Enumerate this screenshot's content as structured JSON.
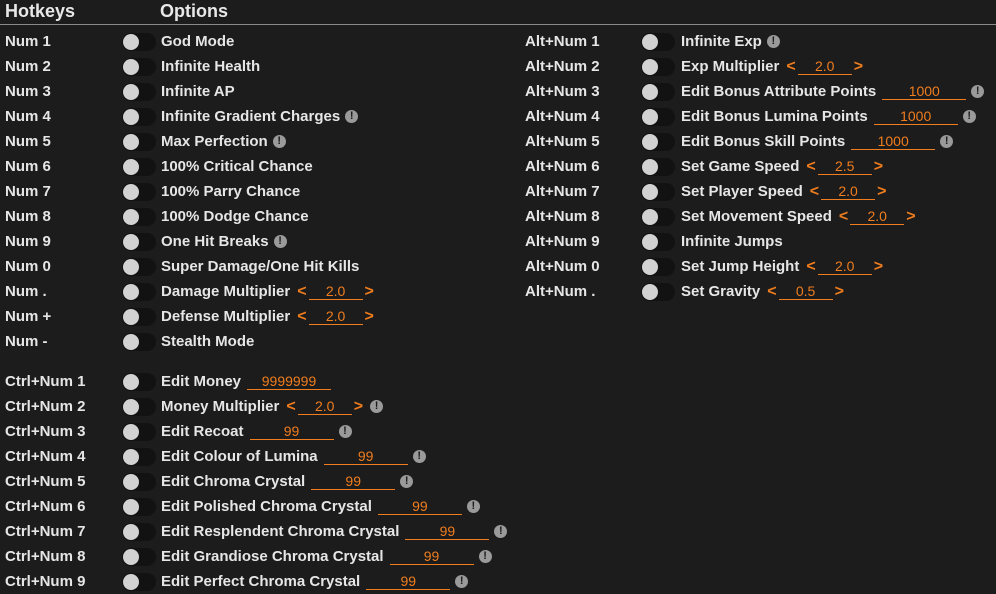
{
  "header": {
    "hotkeys_label": "Hotkeys",
    "options_label": "Options"
  },
  "left_column": [
    {
      "hotkey": "Num 1",
      "label": "God Mode"
    },
    {
      "hotkey": "Num 2",
      "label": "Infinite Health"
    },
    {
      "hotkey": "Num 3",
      "label": "Infinite AP"
    },
    {
      "hotkey": "Num 4",
      "label": "Infinite Gradient Charges",
      "info": true
    },
    {
      "hotkey": "Num 5",
      "label": "Max Perfection",
      "info": true
    },
    {
      "hotkey": "Num 6",
      "label": "100% Critical Chance"
    },
    {
      "hotkey": "Num 7",
      "label": "100% Parry Chance"
    },
    {
      "hotkey": "Num 8",
      "label": "100% Dodge Chance"
    },
    {
      "hotkey": "Num 9",
      "label": "One Hit Breaks",
      "info": true
    },
    {
      "hotkey": "Num 0",
      "label": "Super Damage/One Hit Kills"
    },
    {
      "hotkey": "Num .",
      "label": "Damage Multiplier",
      "stepper": true,
      "value": "2.0"
    },
    {
      "hotkey": "Num +",
      "label": "Defense Multiplier",
      "stepper": true,
      "value": "2.0"
    },
    {
      "hotkey": "Num -",
      "label": "Stealth Mode"
    },
    {
      "gap": true
    },
    {
      "hotkey": "Ctrl+Num 1",
      "label": "Edit Money",
      "value": "9999999"
    },
    {
      "hotkey": "Ctrl+Num 2",
      "label": "Money Multiplier",
      "stepper": true,
      "value": "2.0",
      "info": true
    },
    {
      "hotkey": "Ctrl+Num 3",
      "label": "Edit Recoat",
      "value": "99",
      "info": true
    },
    {
      "hotkey": "Ctrl+Num 4",
      "label": "Edit Colour of Lumina",
      "value": "99",
      "info": true
    },
    {
      "hotkey": "Ctrl+Num 5",
      "label": "Edit Chroma Crystal",
      "value": "99",
      "info": true
    },
    {
      "hotkey": "Ctrl+Num 6",
      "label": "Edit Polished Chroma Crystal",
      "value": "99",
      "info": true
    },
    {
      "hotkey": "Ctrl+Num 7",
      "label": "Edit Resplendent Chroma Crystal",
      "value": "99",
      "info": true
    },
    {
      "hotkey": "Ctrl+Num 8",
      "label": "Edit Grandiose Chroma Crystal",
      "value": "99",
      "info": true
    },
    {
      "hotkey": "Ctrl+Num 9",
      "label": "Edit Perfect Chroma Crystal",
      "value": "99",
      "info": true
    }
  ],
  "right_column": [
    {
      "hotkey": "Alt+Num 1",
      "label": "Infinite Exp",
      "info": true
    },
    {
      "hotkey": "Alt+Num 2",
      "label": "Exp Multiplier",
      "stepper": true,
      "value": "2.0"
    },
    {
      "hotkey": "Alt+Num 3",
      "label": "Edit Bonus Attribute Points",
      "value": "1000",
      "info": true
    },
    {
      "hotkey": "Alt+Num 4",
      "label": "Edit Bonus Lumina Points",
      "value": "1000",
      "info": true
    },
    {
      "hotkey": "Alt+Num 5",
      "label": "Edit Bonus Skill Points",
      "value": "1000",
      "info": true
    },
    {
      "hotkey": "Alt+Num 6",
      "label": "Set Game Speed",
      "stepper": true,
      "value": "2.5"
    },
    {
      "hotkey": "Alt+Num 7",
      "label": "Set Player Speed",
      "stepper": true,
      "value": "2.0"
    },
    {
      "hotkey": "Alt+Num 8",
      "label": "Set Movement Speed",
      "stepper": true,
      "value": "2.0"
    },
    {
      "hotkey": "Alt+Num 9",
      "label": "Infinite Jumps"
    },
    {
      "hotkey": "Alt+Num 0",
      "label": "Set Jump Height",
      "stepper": true,
      "value": "2.0"
    },
    {
      "hotkey": "Alt+Num .",
      "label": "Set Gravity",
      "stepper": true,
      "value": "0.5"
    }
  ],
  "glyphs": {
    "arrow_left": "<",
    "arrow_right": ">",
    "info": "!"
  },
  "colors": {
    "background": "#1c1c1c",
    "text": "#e6e6e6",
    "accent": "#f07d1e",
    "toggle_track": "#121212",
    "toggle_knob": "#d2d2d2"
  }
}
